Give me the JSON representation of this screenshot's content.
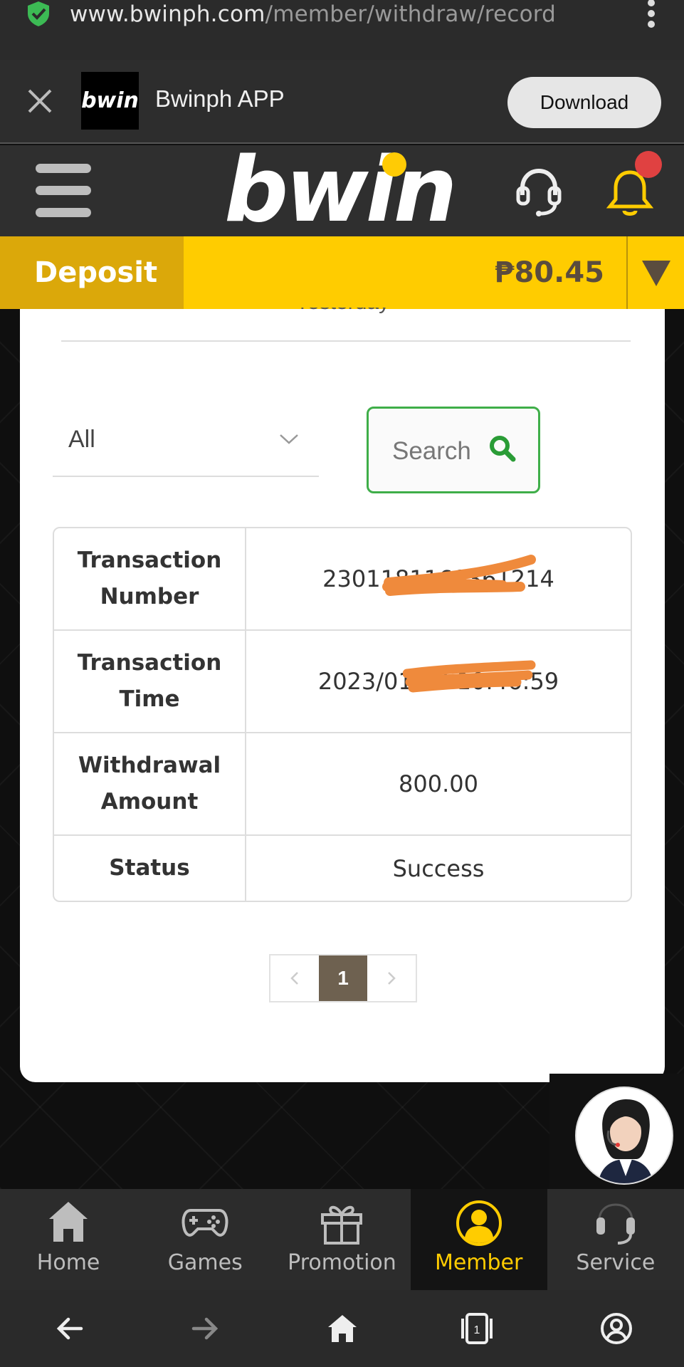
{
  "browser": {
    "url_domain": "www.bwinph.com",
    "url_path": "/member/withdraw/record"
  },
  "app_banner": {
    "logo_text": "bwin",
    "app_name": "Bwinph APP",
    "download_label": "Download"
  },
  "header": {
    "brand": "bwin"
  },
  "balance_bar": {
    "deposit_label": "Deposit",
    "balance": "₱80.45"
  },
  "filter": {
    "partially_hidden_text": "Yesterday",
    "type_value": "All",
    "search_label": "Search"
  },
  "record": {
    "rows": [
      {
        "key_line1": "Transaction",
        "key_line2": "Number",
        "value": "2301181160361214"
      },
      {
        "key_line1": "Transaction",
        "key_line2": "Time",
        "value": "2023/01/18 10:46:59"
      },
      {
        "key_line1": "Withdrawal",
        "key_line2": "Amount",
        "value": "800.00"
      },
      {
        "key_line1": "Status",
        "key_line2": "",
        "value": "Success"
      }
    ]
  },
  "pagination": {
    "current_page": "1"
  },
  "bottom_nav": {
    "items": [
      {
        "label": "Home",
        "icon": "home-icon"
      },
      {
        "label": "Games",
        "icon": "gamepad-icon"
      },
      {
        "label": "Promotion",
        "icon": "gift-icon"
      },
      {
        "label": "Member",
        "icon": "member-icon",
        "active": true
      },
      {
        "label": "Service",
        "icon": "headset-icon"
      }
    ]
  },
  "system_nav": {
    "tab_count": "1"
  },
  "colors": {
    "brand_yellow": "#ffcc00",
    "deposit_gold": "#dba80a",
    "search_green": "#3fae49",
    "redaction_orange": "#ef8a3c",
    "notification_red": "#e04141"
  }
}
